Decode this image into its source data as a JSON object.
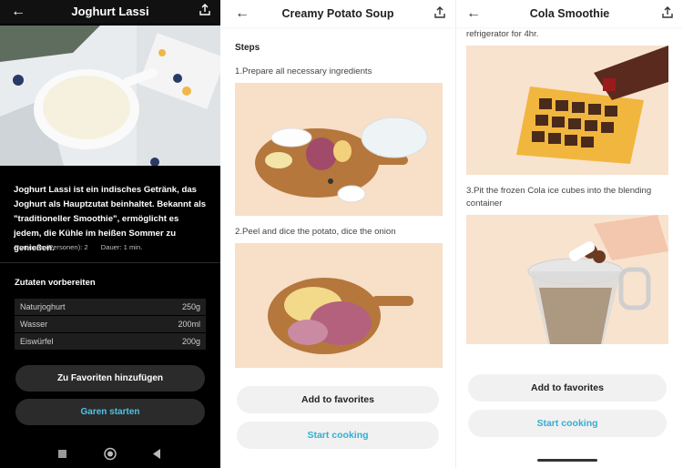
{
  "screen1": {
    "title": "Joghurt Lassi",
    "description": "Joghurt Lassi ist ein indisches Getränk, das Joghurt als Hauptzutat beinhaltet. Bekannt als \"traditioneller Smoothie\", ermöglicht es jedem, die Kühle im heißen Sommer zu genießen.",
    "portions": "Portionen (Personen): 2",
    "duration": "Dauer: 1 min.",
    "ingredients_title": "Zutaten vorbereiten",
    "ingredients": [
      {
        "name": "Naturjoghurt",
        "qty": "250g"
      },
      {
        "name": "Wasser",
        "qty": "200ml"
      },
      {
        "name": "Eiswürfel",
        "qty": "200g"
      }
    ],
    "favorite_label": "Zu Favoriten hinzufügen",
    "cook_label": "Garen starten",
    "colors": {
      "accent": "#4fc3e6",
      "background": "#000000"
    }
  },
  "screen2": {
    "title": "Creamy Potato Soup",
    "steps_heading": "Steps",
    "steps": [
      "1.Prepare all necessary ingredients",
      "2.Peel and dice the potato, dice the onion"
    ],
    "favorite_label": "Add to favorites",
    "cook_label": "Start cooking"
  },
  "screen3": {
    "title": "Cola Smoothie",
    "steps": [
      "refrigerator for 4hr.",
      "3.Pit the frozen Cola ice cubes into the blending container"
    ],
    "favorite_label": "Add to favorites",
    "cook_label": "Start cooking",
    "colors": {
      "accent": "#33aed0"
    }
  }
}
